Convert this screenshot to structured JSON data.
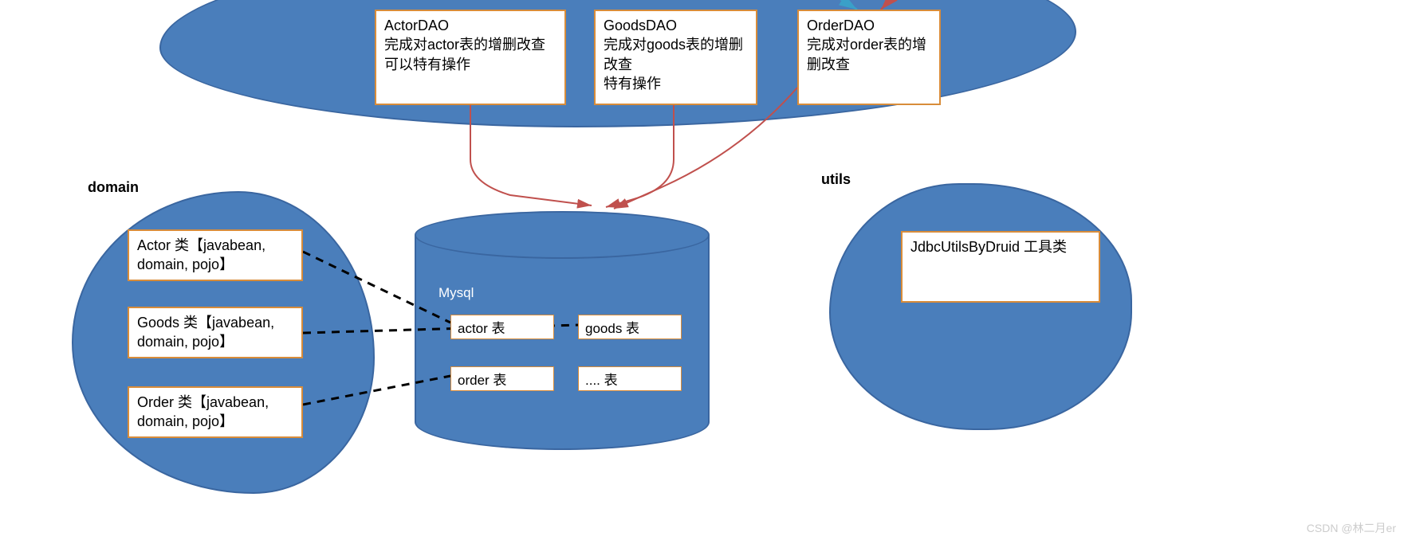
{
  "dao": {
    "actor": {
      "title": "ActorDAO",
      "line1": "完成对actor表的增删改查",
      "line2": "可以特有操作"
    },
    "goods": {
      "title": "GoodsDAO",
      "line1": "完成对goods表的增删改查",
      "line2": "特有操作"
    },
    "order": {
      "title": "OrderDAO",
      "line1": "完成对order表的增删改查",
      "line2": ""
    }
  },
  "domain": {
    "label": "domain",
    "actor": "Actor 类【javabean, domain, pojo】",
    "goods": "Goods 类【javabean, domain, pojo】",
    "order": "Order 类【javabean, domain, pojo】"
  },
  "db": {
    "label": "Mysql",
    "actor": "actor 表",
    "goods": "goods 表",
    "order": "order 表",
    "etc": ".... 表"
  },
  "utils": {
    "label": "utils",
    "jdbc": "JdbcUtilsByDruid 工具类"
  },
  "watermark": "CSDN @林二月er"
}
